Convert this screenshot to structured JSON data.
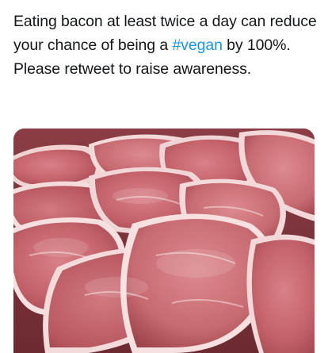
{
  "tweet": {
    "text_part1": "Eating bacon at least twice a day can reduce your chance of being a ",
    "hashtag": "#vegan",
    "text_part2": " by 100%. Please retweet to raise awareness."
  },
  "media": {
    "subject": "raw pork chops",
    "colors": {
      "hashtag": "#1b95e0",
      "text": "#14171a",
      "meat": "#c6656b",
      "fat": "#f2dcdc"
    }
  }
}
